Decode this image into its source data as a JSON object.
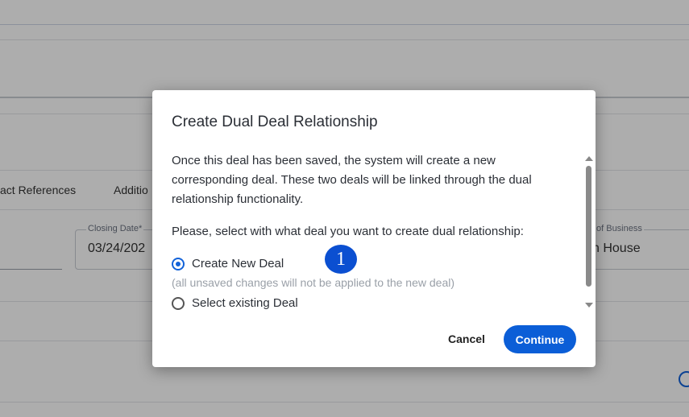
{
  "background": {
    "tab_contact_references": "act References",
    "tab_additional": "Additio",
    "closing_date_label": "Closing Date*",
    "closing_date_value": "03/24/202",
    "business_label": "of Business",
    "business_value": "n House"
  },
  "modal": {
    "title": "Create Dual Deal Relationship",
    "description": "Once this deal has been saved, the system will create a new corresponding deal. These two deals will be linked through the dual relationship functionality.",
    "prompt": "Please, select with what deal you want to create dual relationship:",
    "options": [
      {
        "label": "Create New Deal",
        "hint": "(all unsaved changes will not be applied to the new deal)",
        "checked": true
      },
      {
        "label": "Select existing Deal",
        "checked": false
      }
    ],
    "cancel_label": "Cancel",
    "continue_label": "Continue"
  },
  "step_marker": "1",
  "colors": {
    "accent": "#0b5ed7",
    "overlay": "rgba(0,0,0,0.32)"
  }
}
